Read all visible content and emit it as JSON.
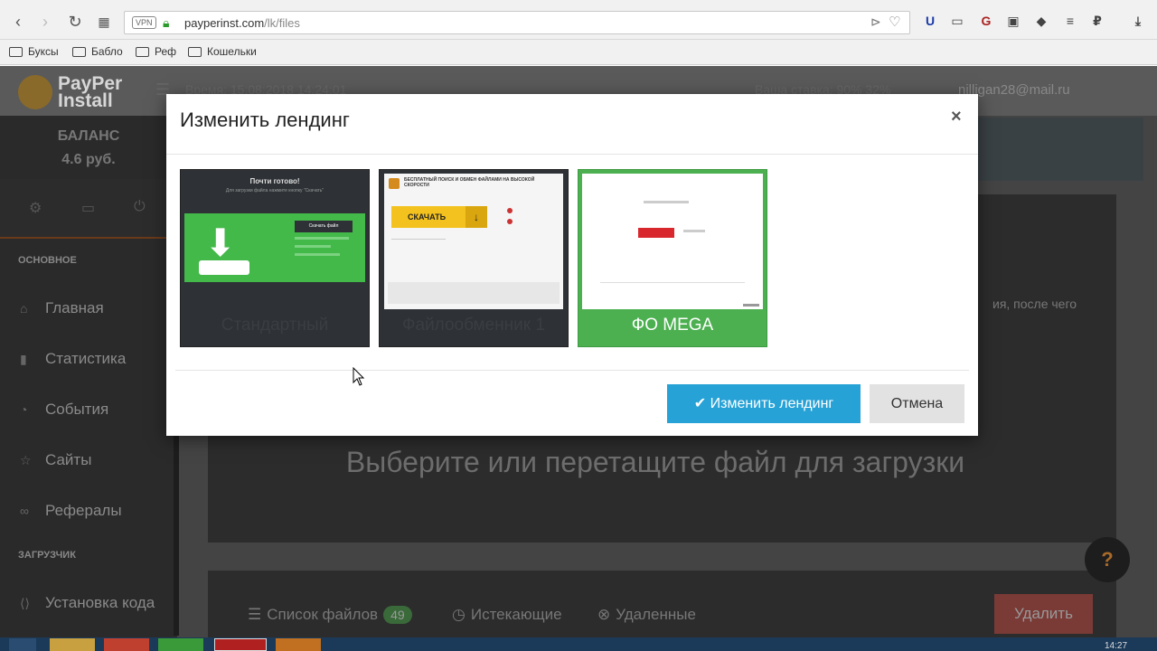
{
  "browser": {
    "url_host": "payperinst.com",
    "url_path": "/lk/files",
    "vpn_label": "VPN",
    "bookmarks": [
      "Буксы",
      "Бабло",
      "Реф",
      "Кошельки"
    ]
  },
  "header": {
    "logo_line1": "PayPer",
    "logo_line2": "Install",
    "left_text": "Время: 15:08:2018 14:24:01",
    "right_text": "Ваша ставка: 90%   32%",
    "email": "nilligan28@mail.ru"
  },
  "sidebar": {
    "balance_title": "БАЛАНС",
    "balance_value": "4.6 руб.",
    "section_main": "ОСНОВНОЕ",
    "items": [
      "Главная",
      "Статистика",
      "События",
      "Сайты",
      "Рефералы"
    ],
    "section_loader": "ЗАГРУЗЧИК",
    "loader_items": [
      "Установка кода"
    ]
  },
  "main": {
    "hint_text": "ия, после чего",
    "dropzone_text": "Выберите или перетащите файл для загрузки",
    "tabs": [
      {
        "label": "Список файлов",
        "badge": "49"
      },
      {
        "label": "Истекающие"
      },
      {
        "label": "Удаленные"
      }
    ],
    "delete_label": "Удалить",
    "help_label": "?"
  },
  "modal": {
    "title": "Изменить лендинг",
    "close": "×",
    "cards": [
      {
        "label": "Стандартный",
        "heading": "Почти готово!",
        "sub": "Для загрузки файла нажмите кнопку \"Скачать\"",
        "button": "Скачать файл"
      },
      {
        "label": "Файлообменник 1",
        "heading": "БЕСПЛАТНЫЙ ПОИСК И ОБМЕН ФАЙЛАМИ НА ВЫСОКОЙ СКОРОСТИ",
        "button": "СКАЧАТЬ"
      },
      {
        "label": "ФО MEGA"
      }
    ],
    "confirm_label": "Изменить лендинг",
    "cancel_label": "Отмена"
  },
  "taskbar": {
    "clock": "14:27"
  }
}
